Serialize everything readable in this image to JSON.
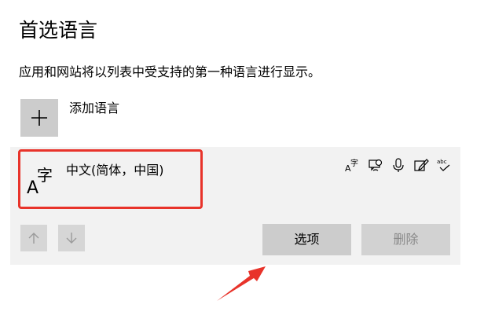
{
  "title": "首选语言",
  "description": "应用和网站将以列表中受支持的第一种语言进行显示。",
  "add_language": {
    "label": "添加语言",
    "icon": "plus-icon"
  },
  "language": {
    "name": "中文(简体，中国)",
    "glyph_icon": "language-char-icon",
    "features": [
      "display-language-icon",
      "text-to-speech-icon",
      "speech-recognition-icon",
      "handwriting-icon",
      "spell-check-icon"
    ]
  },
  "buttons": {
    "options_label": "选项",
    "remove_label": "删除"
  },
  "colors": {
    "highlight_border": "#e8332a",
    "annotation_arrow": "#e8332a",
    "button_bg": "#cccccc",
    "card_bg": "#f2f2f2"
  }
}
